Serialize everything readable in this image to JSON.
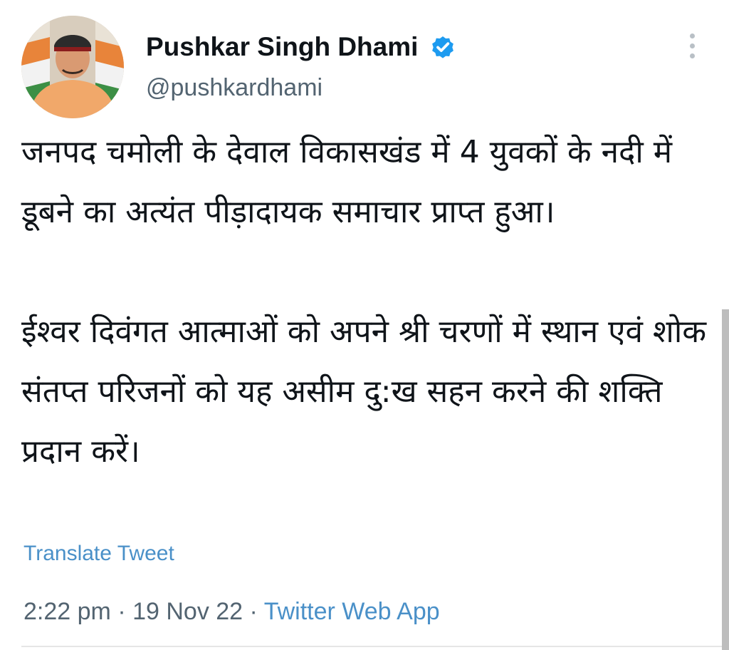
{
  "tweet": {
    "author": {
      "display_name": "Pushkar Singh Dhami",
      "handle": "@pushkardhami",
      "verified": true,
      "avatar_icon": "profile-photo"
    },
    "text_paragraph_1": "जनपद चमोली के देवाल विकासखंड में 4 युवकों के नदी में डूबने का अत्यंत पीड़ादायक समाचार प्राप्त हुआ।",
    "text_paragraph_2": "ईश्वर दिवंगत आत्माओं को अपने श्री चरणों में स्थान एवं शोक संतप्त परिजनों को यह असीम दु:ख सहन करने की शक्ति प्रदान करें।",
    "translate_label": "Translate Tweet",
    "time": "2:22 pm",
    "separator": "·",
    "date": "19 Nov 22",
    "source": "Twitter Web App"
  },
  "colors": {
    "text": "#0f1419",
    "secondary_text": "#536471",
    "link": "#4a90c8",
    "verified_badge": "#1d9bf0"
  }
}
